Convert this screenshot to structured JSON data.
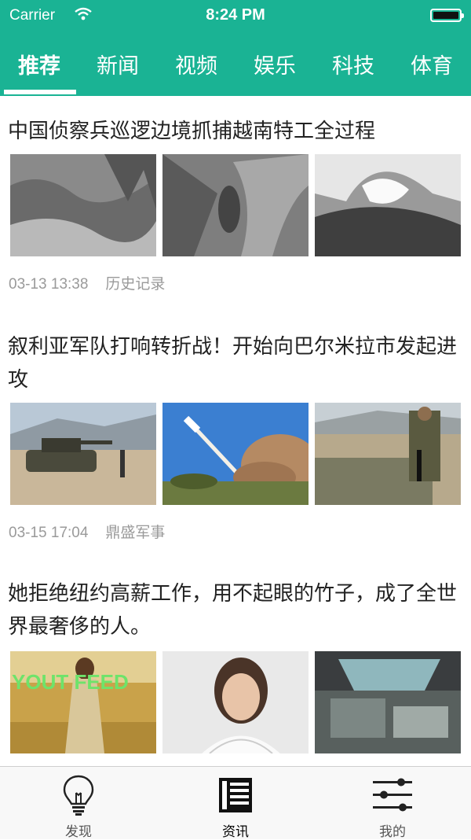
{
  "status_bar": {
    "carrier": "Carrier",
    "time": "8:24 PM"
  },
  "tabs": [
    {
      "label": "推荐",
      "active": true
    },
    {
      "label": "新闻"
    },
    {
      "label": "视频"
    },
    {
      "label": "娱乐"
    },
    {
      "label": "科技"
    },
    {
      "label": "体育"
    }
  ],
  "articles": [
    {
      "title": "中国侦察兵巡逻边境抓捕越南特工全过程",
      "time": "03-13 13:38",
      "source": "历史记录"
    },
    {
      "title": "叙利亚军队打响转折战！开始向巴尔米拉市发起进攻",
      "time": "03-15 17:04",
      "source": "鼎盛军事"
    },
    {
      "title": "她拒绝纽约高薪工作，用不起眼的竹子，成了全世界最奢侈的人。",
      "thumb_overlay": "YOUT FEED"
    }
  ],
  "bottom_nav": [
    {
      "label": "发现",
      "icon": "lightbulb-icon"
    },
    {
      "label": "资讯",
      "icon": "newspaper-icon",
      "active": true
    },
    {
      "label": "我的",
      "icon": "sliders-icon"
    }
  ],
  "colors": {
    "accent": "#1ab394",
    "meta_text": "#9a9a9a"
  }
}
